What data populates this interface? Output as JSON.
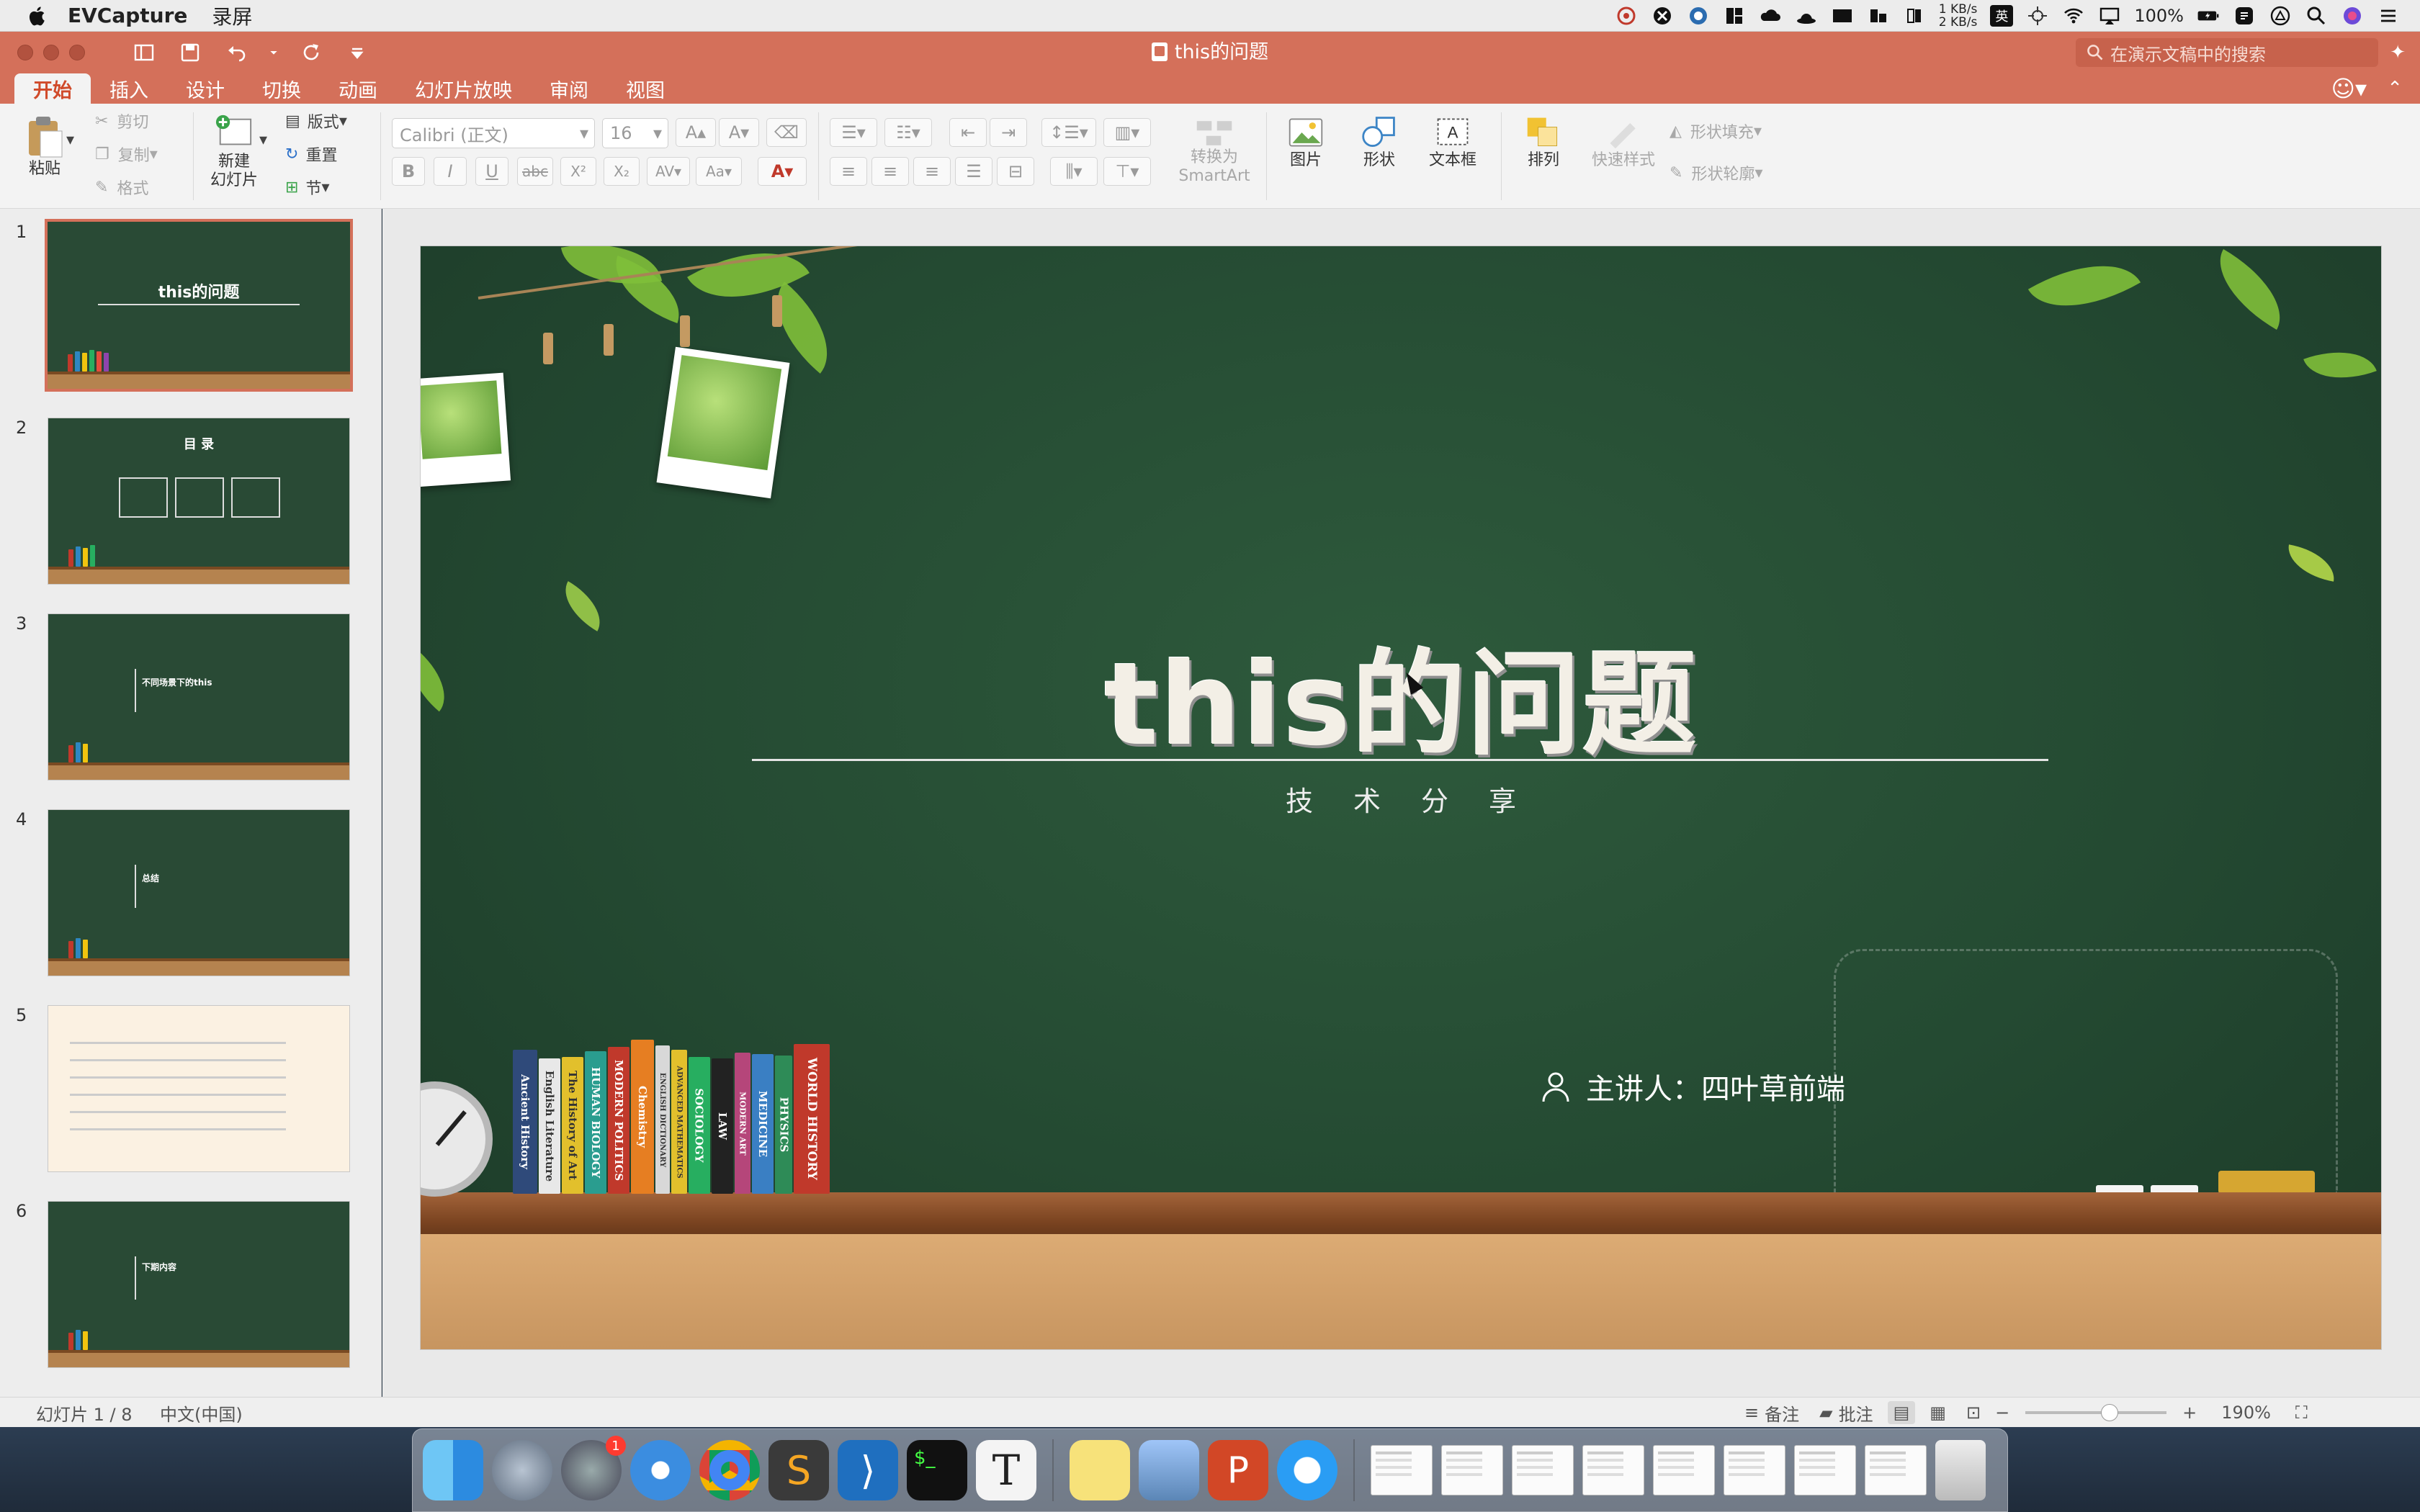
{
  "menubar": {
    "app_name": "EVCapture",
    "menus": [
      "录屏"
    ],
    "net_up": "1 KB/s",
    "net_down": "2 KB/s",
    "input_method": "英",
    "battery": "100%"
  },
  "window": {
    "title": "this的问题",
    "search_placeholder": "在演示文稿中的搜索"
  },
  "tabs": [
    "开始",
    "插入",
    "设计",
    "切换",
    "动画",
    "幻灯片放映",
    "审阅",
    "视图"
  ],
  "ribbon": {
    "paste": "粘贴",
    "cut": "剪切",
    "copy": "复制",
    "format": "格式",
    "new_slide": "新建\n幻灯片",
    "layout": "版式",
    "reset": "重置",
    "section": "节",
    "font_name": "Calibri (正文)",
    "font_size": "16",
    "convert_smartart": "转换为\nSmartArt",
    "picture": "图片",
    "shape": "形状",
    "textbox": "文本框",
    "arrange": "排列",
    "quick_styles": "快速样式",
    "shape_fill": "形状填充",
    "shape_outline": "形状轮廓"
  },
  "thumbnails": [
    {
      "num": "1",
      "title": "this的问题"
    },
    {
      "num": "2",
      "title": "目 录"
    },
    {
      "num": "3",
      "title": "不同场景下的this"
    },
    {
      "num": "4",
      "title": "总结"
    },
    {
      "num": "5",
      "title": ""
    },
    {
      "num": "6",
      "title": "下期内容"
    }
  ],
  "slide": {
    "title": "this的问题",
    "subtitle": "技术分享",
    "presenter": "主讲人：四叶草前端",
    "books": [
      "Ancient History",
      "English Literature",
      "The History of Art",
      "HUMAN BIOLOGY",
      "MODERN POLITICS",
      "Chemistry",
      "ENGLISH DICTIONARY",
      "ADVANCED MATHEMATICS",
      "SOCIOLOGY",
      "LAW",
      "MODERN ART",
      "MEDICINE",
      "PHYSICS",
      "WORLD HISTORY"
    ]
  },
  "statusbar": {
    "slide_pos": "幻灯片 1 / 8",
    "language": "中文(中国)",
    "notes": "备注",
    "comments": "批注",
    "zoom": "190%",
    "zoom_level": 0.61
  },
  "dock": {
    "badge": "1"
  },
  "colors": {
    "accent": "#d4705a",
    "tab_active": "#d04a2a",
    "board": "#2e5a3c"
  }
}
